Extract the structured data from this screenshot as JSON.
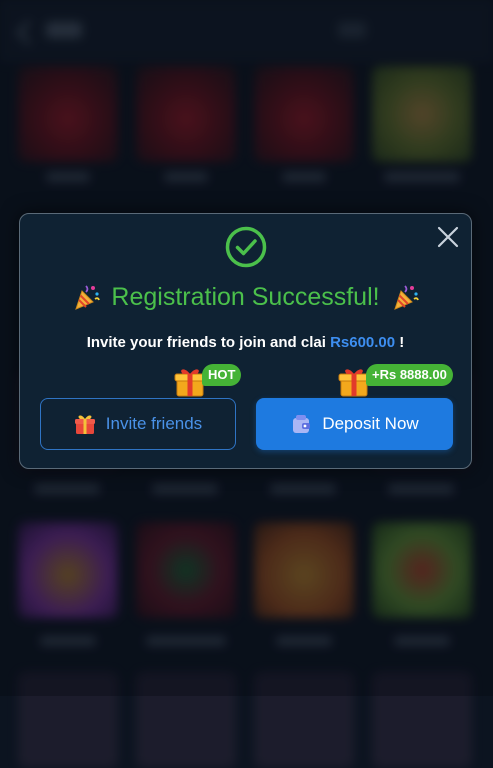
{
  "modal": {
    "title": "Registration Successful!",
    "subtitle_prefix": "Invite your friends to join and clai ",
    "subtitle_amount": "Rs600.00",
    "subtitle_suffix": " !",
    "invite_button": {
      "label": "Invite friends",
      "badge": "HOT",
      "icon": "gift-icon",
      "badge_icon": "gift-box-icon"
    },
    "deposit_button": {
      "label": "Deposit Now",
      "badge": "+Rs 8888.00",
      "icon": "wallet-icon",
      "badge_icon": "gift-box-icon"
    },
    "success_icon": "check-circle-icon",
    "decor_icon": "party-popper-icon",
    "close_icon": "close-icon"
  },
  "colors": {
    "success_green": "#4bc04b",
    "accent_blue": "#1e7ae0",
    "amount_blue": "#3d8ef0",
    "badge_green": "#45b336",
    "modal_bg": "#0f2233",
    "page_bg": "#0c1420"
  }
}
